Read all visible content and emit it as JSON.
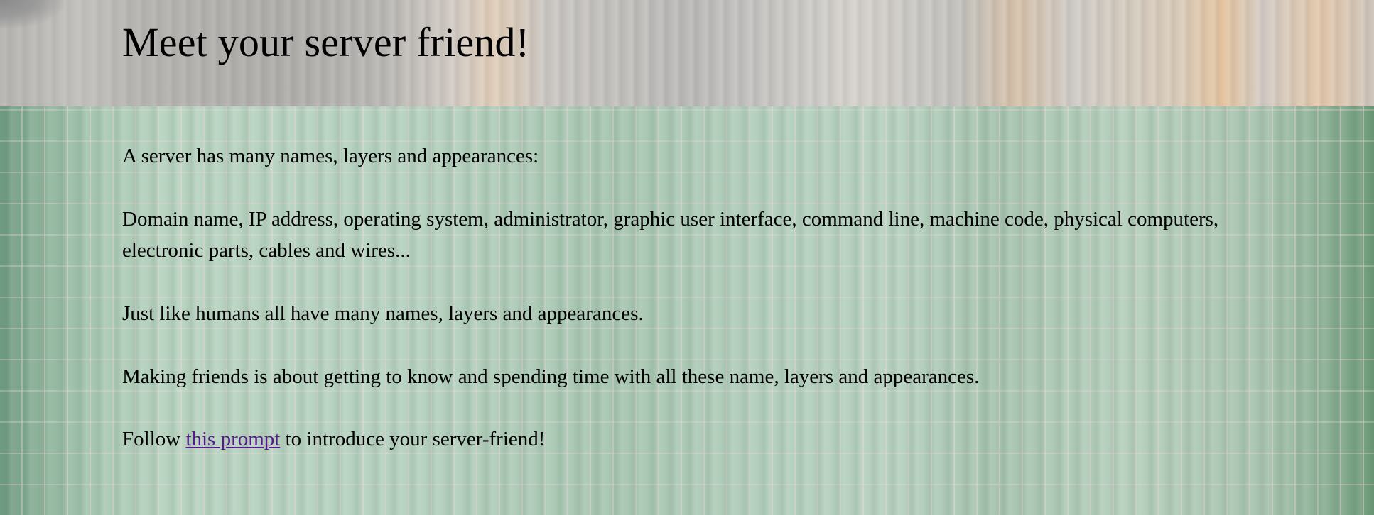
{
  "page": {
    "title": "Meet your server friend!",
    "paragraphs": [
      "A server has many names, layers and appearances:",
      "Domain name, IP address, operating system, administrator, graphic user interface, command line, machine code, physical computers, electronic parts, cables and wires...",
      "Just like humans all have many names, layers and appearances.",
      "Making friends is about getting to know and spending time with all these name, layers and appearances."
    ],
    "follow": {
      "before": "Follow ",
      "link_text": "this prompt",
      "after": " to introduce your server-friend!"
    }
  },
  "colors": {
    "text": "#000000",
    "visited_link": "#551a8b"
  }
}
